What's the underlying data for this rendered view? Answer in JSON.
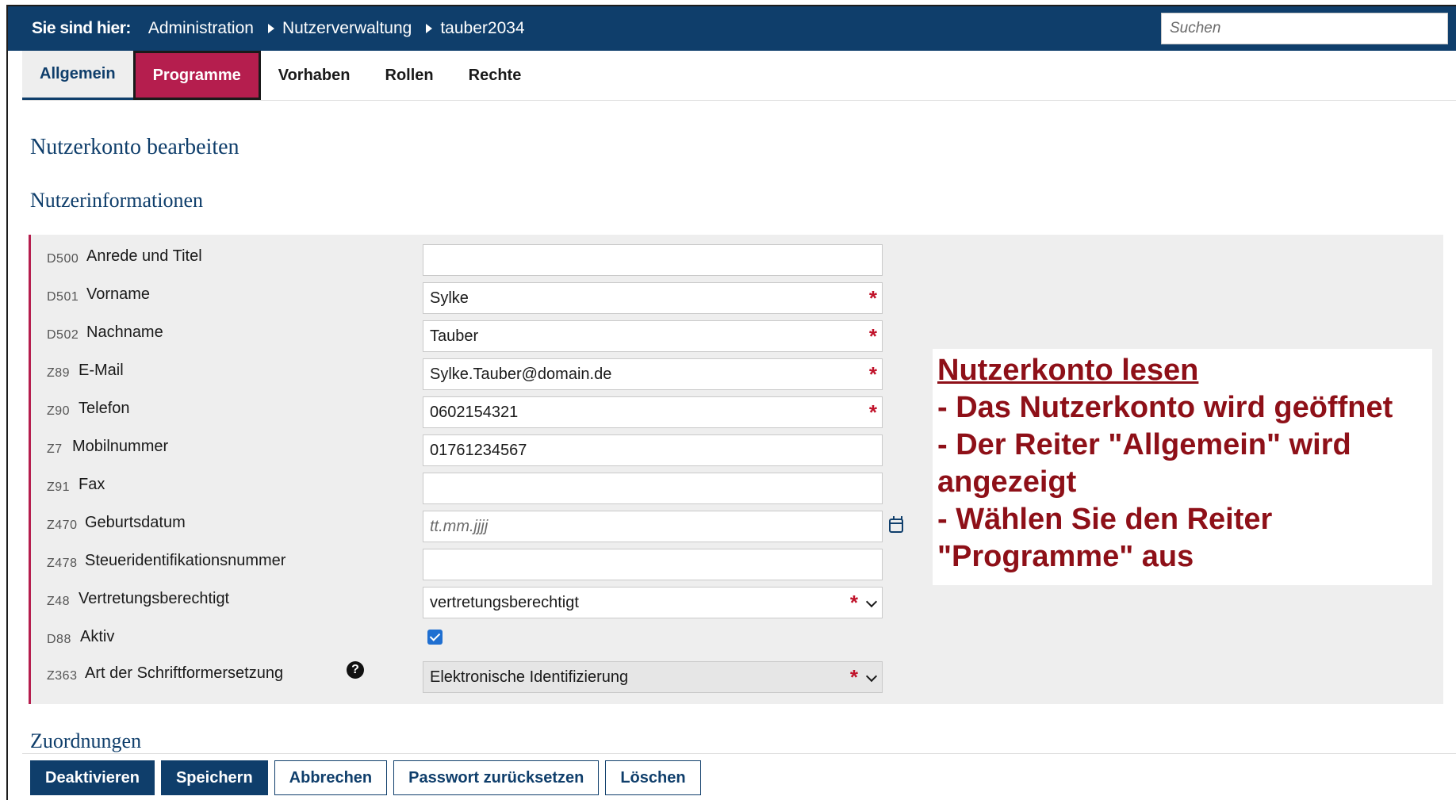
{
  "breadcrumb": {
    "label": "Sie sind hier:",
    "items": [
      "Administration",
      "Nutzerverwaltung",
      "tauber2034"
    ]
  },
  "search": {
    "placeholder": "Suchen"
  },
  "tabs": [
    {
      "label": "Allgemein",
      "state": "active"
    },
    {
      "label": "Programme",
      "state": "highlight"
    },
    {
      "label": "Vorhaben",
      "state": "normal"
    },
    {
      "label": "Rollen",
      "state": "normal"
    },
    {
      "label": "Rechte",
      "state": "normal"
    }
  ],
  "headings": {
    "page_title": "Nutzerkonto bearbeiten",
    "section_info": "Nutzerinformationen",
    "section_assignments": "Zuordnungen"
  },
  "form": {
    "rows": [
      {
        "code": "D500",
        "label": "Anrede und Titel",
        "value": ""
      },
      {
        "code": "D501",
        "label": "Vorname",
        "value": "Sylke",
        "required": "*"
      },
      {
        "code": "D502",
        "label": "Nachname",
        "value": "Tauber",
        "required": "*"
      },
      {
        "code": "Z89",
        "label": "E-Mail",
        "value": "Sylke.Tauber@domain.de",
        "required": "*"
      },
      {
        "code": "Z90",
        "label": "Telefon",
        "value": "0602154321",
        "required": "*"
      },
      {
        "code": "Z7",
        "label": "Mobilnummer",
        "value": "01761234567"
      },
      {
        "code": "Z91",
        "label": "Fax",
        "value": ""
      },
      {
        "code": "Z470",
        "label": "Geburtsdatum",
        "placeholder": "tt.mm.jjjj"
      },
      {
        "code": "Z478",
        "label": "Steueridentifikationsnummer",
        "value": ""
      },
      {
        "code": "Z48",
        "label": "Vertretungsberechtigt",
        "value": "vertretungsberechtigt",
        "required": "*"
      },
      {
        "code": "D88",
        "label": "Aktiv"
      },
      {
        "code": "Z363",
        "label": "Art der Schriftformersetzung",
        "value": "Elektronische Identifizierung",
        "required": "*",
        "help": "?"
      }
    ]
  },
  "annotation": {
    "title": "Nutzerkonto lesen",
    "lines": [
      "- Das Nutzerkonto wird geöffnet",
      "- Der Reiter \"Allgemein\" wird angezeigt",
      "- Wählen Sie den Reiter \"Programme\" aus"
    ]
  },
  "buttons": {
    "deactivate": "Deaktivieren",
    "save": "Speichern",
    "cancel": "Abbrechen",
    "reset_password": "Passwort zurücksetzen",
    "delete": "Löschen"
  },
  "colors": {
    "primary": "#0f3e6b",
    "highlight": "#b51e4e",
    "required": "#c0122a",
    "annotation": "#8e1018"
  }
}
